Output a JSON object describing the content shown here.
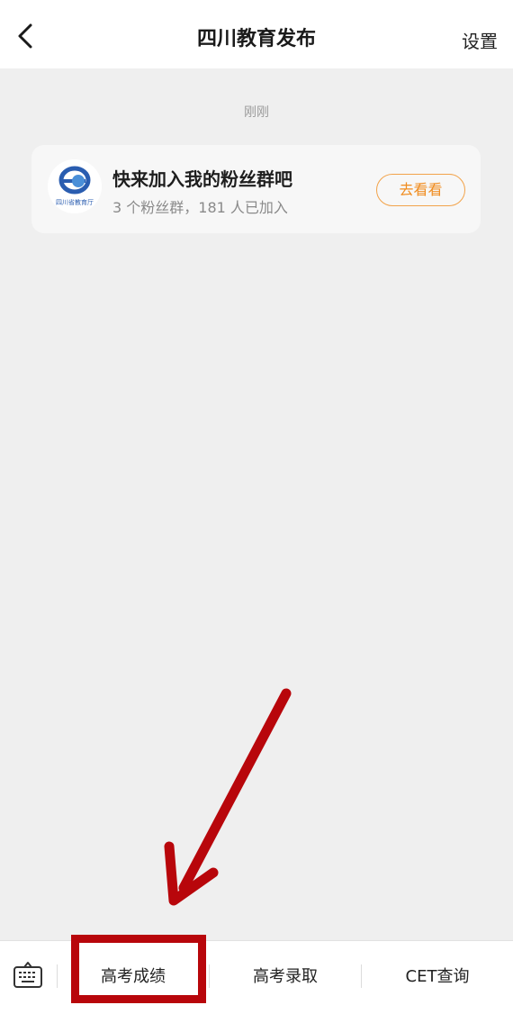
{
  "header": {
    "title": "四川教育发布",
    "settings_label": "设置"
  },
  "chat": {
    "timestamp": "刚刚",
    "card": {
      "title": "快来加入我的粉丝群吧",
      "subtitle": "3 个粉丝群，181 人已加入",
      "button_label": "去看看",
      "avatar_caption": "四川省教育厅"
    }
  },
  "bottom_menu": {
    "items": [
      {
        "label": "高考成绩"
      },
      {
        "label": "高考录取"
      },
      {
        "label": "CET查询"
      }
    ]
  },
  "colors": {
    "accent_orange": "#f08c1f",
    "annotation_red": "#b8060b",
    "logo_blue": "#2a5db0"
  }
}
